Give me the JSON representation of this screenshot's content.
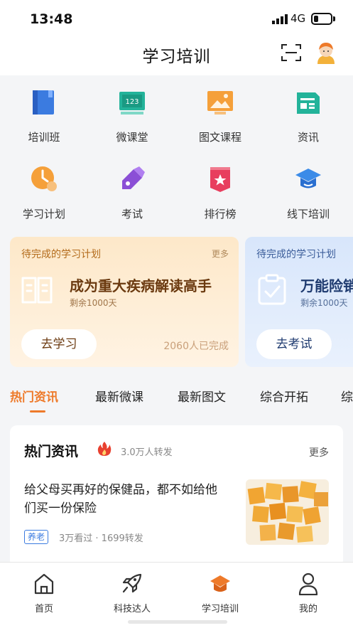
{
  "status": {
    "time": "13:48",
    "network": "4G"
  },
  "header": {
    "title": "学习培训",
    "scan_icon": "scan-icon",
    "avatar_icon": "avatar"
  },
  "grid": [
    {
      "label": "培训班",
      "icon": "book-icon"
    },
    {
      "label": "微课堂",
      "icon": "board-icon"
    },
    {
      "label": "图文课程",
      "icon": "picture-icon"
    },
    {
      "label": "资讯",
      "icon": "news-icon"
    },
    {
      "label": "学习计划",
      "icon": "clock-icon"
    },
    {
      "label": "考试",
      "icon": "pen-icon"
    },
    {
      "label": "排行榜",
      "icon": "rank-icon"
    },
    {
      "label": "线下培训",
      "icon": "graduation-cap-icon"
    }
  ],
  "cards": [
    {
      "label": "待完成的学习计划",
      "more": "更多",
      "title": "成为重大疾病解读高手",
      "sub": "剩余1000天",
      "button": "去学习",
      "done": "2060人已完成",
      "accent": "#ee7a2a"
    },
    {
      "label": "待完成的学习计划",
      "title": "万能险销",
      "sub": "剩余1000天",
      "button": "去考试",
      "accent": "#3b7be0"
    }
  ],
  "tabs": [
    "热门资讯",
    "最新微课",
    "最新图文",
    "综合开拓",
    "综"
  ],
  "news": {
    "title": "热门资讯",
    "shares": "3.0万人转发",
    "more": "更多",
    "article": {
      "text": "给父母买再好的保健品，都不如给他们买一份保险",
      "tag": "养老",
      "meta": "3万看过 · 1699转发"
    }
  },
  "tabbar": [
    {
      "label": "首页",
      "icon": "home-icon"
    },
    {
      "label": "科技达人",
      "icon": "rocket-icon"
    },
    {
      "label": "学习培训",
      "icon": "graduation-cap-icon"
    },
    {
      "label": "我的",
      "icon": "person-icon"
    }
  ]
}
